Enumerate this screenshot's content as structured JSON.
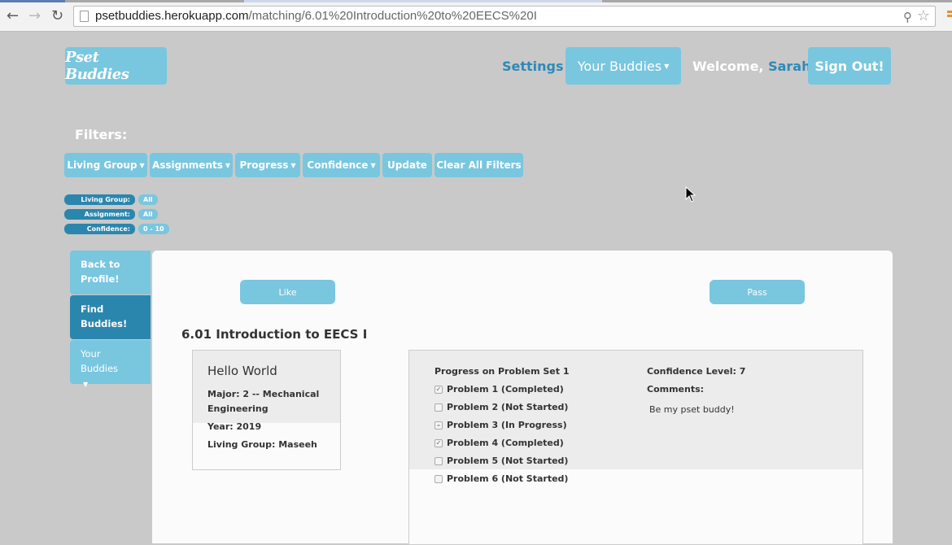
{
  "browser": {
    "url_host": "psetbuddies.herokuapp.com",
    "url_path": "/matching/6.01%20Introduction%20to%20EECS%20I"
  },
  "header": {
    "logo": "Pset Buddies",
    "settings": "Settings",
    "your_buddies": "Your Buddies",
    "welcome_prefix": "Welcome, ",
    "user_name": "Sarah",
    "welcome_suffix": "!",
    "sign_out": "Sign Out!"
  },
  "filters": {
    "title": "Filters:",
    "buttons": [
      "Living Group",
      "Assignments",
      "Progress",
      "Confidence",
      "Update",
      "Clear All Filters"
    ],
    "active": [
      {
        "label": "Living Group:",
        "value": "All"
      },
      {
        "label": "Assignment:",
        "value": "All"
      },
      {
        "label": "Confidence:",
        "value": "0 - 10"
      }
    ]
  },
  "sidebar": {
    "items": [
      {
        "label": "Back to Profile!"
      },
      {
        "label": "Find Buddies!"
      },
      {
        "label": "Your Buddies"
      }
    ]
  },
  "main": {
    "like": "Like",
    "pass": "Pass",
    "class_title": "6.01 Introduction to EECS I",
    "profile": {
      "name": "Hello World",
      "major": "Major: 2 -- Mechanical Engineering",
      "year": "Year: 2019",
      "living_group": "Living Group: Maseeh"
    },
    "progress": {
      "title": "Progress on Problem Set 1",
      "problems": [
        {
          "label": "Problem 1 (Completed)",
          "mark": "✓"
        },
        {
          "label": "Problem 2 (Not Started)",
          "mark": ""
        },
        {
          "label": "Problem 3 (In Progress)",
          "mark": "–"
        },
        {
          "label": "Problem 4 (Completed)",
          "mark": "✓"
        },
        {
          "label": "Problem 5 (Not Started)",
          "mark": ""
        },
        {
          "label": "Problem 6 (Not Started)",
          "mark": ""
        }
      ],
      "confidence": "Confidence Level: 7",
      "comments_label": "Comments:",
      "comment": "Be my pset buddy!"
    }
  }
}
